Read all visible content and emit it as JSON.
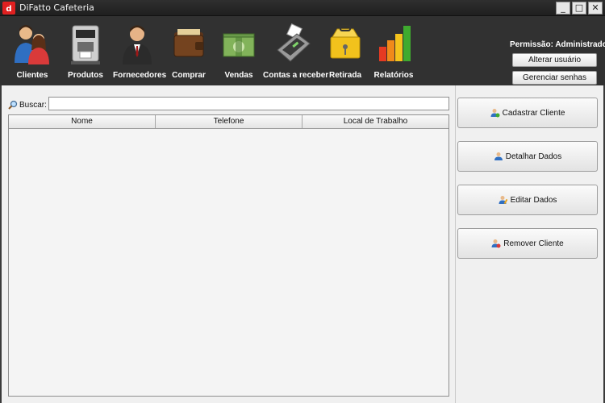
{
  "window": {
    "title": "DiFatto Cafeteria",
    "controls": {
      "minimize": "_",
      "maximize": "□",
      "close": "✕"
    }
  },
  "toolbar": {
    "items": [
      {
        "label": "Clientes",
        "icon": "users-icon"
      },
      {
        "label": "Produtos",
        "icon": "coffee-machine-icon"
      },
      {
        "label": "Fornecedores",
        "icon": "businessman-icon"
      },
      {
        "label": "Comprar",
        "icon": "wallet-icon"
      },
      {
        "label": "Vendas",
        "icon": "money-icon"
      },
      {
        "label": "Contas a receber",
        "icon": "card-machine-icon"
      },
      {
        "label": "Retirada",
        "icon": "cash-box-icon"
      },
      {
        "label": "Relatórios",
        "icon": "bar-chart-icon"
      }
    ],
    "permission": "Permissão: Administrador",
    "change_user": "Alterar usuário",
    "manage_passwords": "Gerenciar senhas"
  },
  "search": {
    "label": "Buscar:",
    "value": "",
    "icon": "search-icon"
  },
  "table": {
    "columns": [
      "Nome",
      "Telefone",
      "Local de Trabalho"
    ],
    "rows": []
  },
  "actions": [
    {
      "label": "Cadastrar Cliente",
      "icon": "user-add-icon"
    },
    {
      "label": "Detalhar Dados",
      "icon": "user-icon"
    },
    {
      "label": "Editar Dados",
      "icon": "user-edit-icon"
    },
    {
      "label": "Remover Cliente",
      "icon": "user-remove-icon"
    }
  ],
  "colors": {
    "toolbar_bg": "#313131",
    "panel_bg": "#f0f0f0",
    "accent_red": "#e02020"
  }
}
